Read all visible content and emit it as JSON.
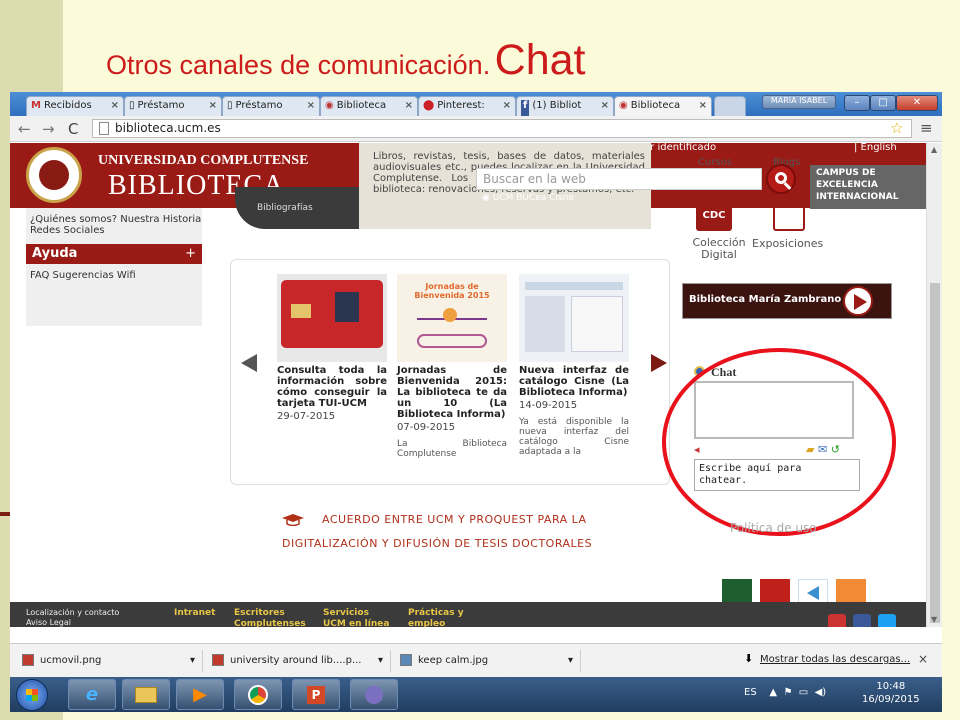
{
  "slide": {
    "title_part1": "Otros canales de comunicación.",
    "title_part2": "Chat"
  },
  "browser": {
    "tabs": [
      {
        "label": "Recibidos"
      },
      {
        "label": "Préstamo"
      },
      {
        "label": "Préstamo"
      },
      {
        "label": "Biblioteca"
      },
      {
        "label": "Pinterest:"
      },
      {
        "label": "(1) Bibliot"
      },
      {
        "label": "Biblioteca"
      }
    ],
    "tab_close": "×",
    "window_user": "MARIA ISABEL",
    "url": "biblioteca.ucm.es"
  },
  "site": {
    "university": "UNIVERSIDAD COMPLUTENSE",
    "library": "BIBLIOTECA",
    "dark_block": "Bibliografías",
    "description": "Libros, revistas, tesis, bases de datos, materiales audiovisuales etc., puedes localizar en la Universidad Complutense. Los servicios personalizados de la biblioteca: renovaciones, reservas y préstamos, etc.",
    "top_nav": "Navegar identificado",
    "english": "| English",
    "cursos": "Cursos",
    "blogs": "Blogs",
    "search_placeholder": "Buscar en la web",
    "radio_options": "UCM   BUCea   Cisne",
    "campus": "CAMPUS DE EXCELENCIA INTERNACIONAL",
    "sidebar": {
      "links1": "¿Quiénes somos? Nuestra Historia Redes Sociales",
      "ayuda": "Ayuda",
      "plus": "+",
      "links2": "FAQ  Sugerencias  Wifi"
    },
    "news": [
      {
        "title": "Consulta toda la información sobre cómo conseguir la tarjeta TUI-UCM",
        "date": "29-07-2015",
        "excerpt": ""
      },
      {
        "title": "Jornadas de Bienvenida 2015: La biblioteca te da un 10 (La Biblioteca Informa)",
        "date": "07-09-2015",
        "excerpt": "La Biblioteca Complutense"
      },
      {
        "title": "Nueva interfaz de catálogo Cisne (La Biblioteca Informa)",
        "date": "14-09-2015",
        "excerpt": "Ya está disponible la nueva interfaz del catálogo Cisne adaptada a la"
      }
    ],
    "card_image_text": "Jornadas de Bienvenida 2015",
    "cdc": "CDC",
    "coleccion": "Colección Digital",
    "exposiciones": "Exposiciones",
    "zambrano": "Biblioteca María Zambrano",
    "chat_title": "Chat",
    "chat_input": "Escribe aquí para chatear.",
    "politica": "Política de uso",
    "acuerdo_line1": "ACUERDO ENTRE UCM Y PROQUEST PARA LA",
    "acuerdo_line2": "DIGITALIZACIÓN Y DIFUSIÓN DE TESIS DOCTORALES",
    "footer": {
      "loc": "Localización y contacto",
      "aviso": "Aviso Legal",
      "intranet": "Intranet",
      "escritores": "Escritores Complutenses",
      "servicios": "Servicios UCM en línea",
      "practicas": "Prácticas y empleo"
    }
  },
  "downloads": {
    "items": [
      "ucmovil.png",
      "university around lib....p...",
      "keep calm.jpg"
    ],
    "show_all": "Mostrar todas las descargas...",
    "close": "×"
  },
  "taskbar": {
    "lang": "ES",
    "time": "10:48",
    "date": "16/09/2015"
  },
  "colors": {
    "brand_red": "#9a1a15",
    "highlight_ellipse": "#e8111c",
    "slide_title": "#cc1b1b"
  }
}
